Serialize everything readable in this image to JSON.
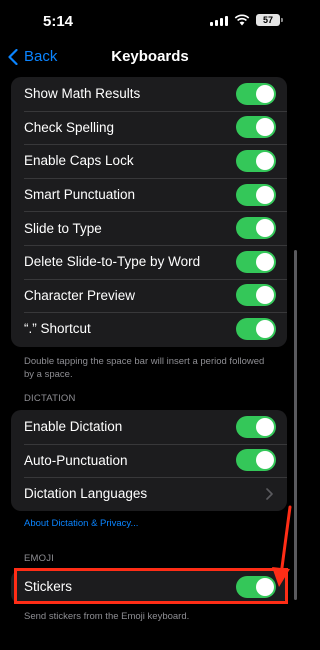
{
  "status_bar": {
    "time": "5:14",
    "battery": "57"
  },
  "nav": {
    "back_label": "Back",
    "title": "Keyboards"
  },
  "keyboard_settings": [
    {
      "label": "Show Math Results",
      "on": true
    },
    {
      "label": "Check Spelling",
      "on": true
    },
    {
      "label": "Enable Caps Lock",
      "on": true
    },
    {
      "label": "Smart Punctuation",
      "on": true
    },
    {
      "label": "Slide to Type",
      "on": true
    },
    {
      "label": "Delete Slide-to-Type by Word",
      "on": true
    },
    {
      "label": "Character Preview",
      "on": true
    },
    {
      "label": "“.” Shortcut",
      "on": true
    }
  ],
  "shortcut_footnote": "Double tapping the space bar will insert a period followed by a space.",
  "dictation": {
    "header": "DICTATION",
    "enable_label": "Enable Dictation",
    "auto_punct_label": "Auto-Punctuation",
    "languages_label": "Dictation Languages",
    "about_link": "About Dictation & Privacy..."
  },
  "emoji": {
    "header": "EMOJI",
    "stickers_label": "Stickers",
    "stickers_footnote": "Send stickers from the Emoji keyboard."
  },
  "colors": {
    "accent": "#0a84ff",
    "toggle_on": "#34c759",
    "annotation": "#ff2d16"
  }
}
